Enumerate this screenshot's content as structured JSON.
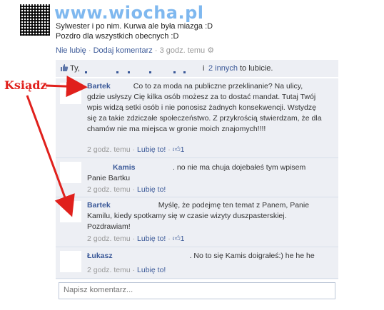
{
  "watermark": "www.wiocha.pl",
  "post": {
    "line1": "Sylwester i po nim. Kurwa ale była miazga :D",
    "line2": "Pozdro dla wszystkich obecnych :D",
    "actions": {
      "unlike": "Nie lubię",
      "comment": "Dodaj komentarz",
      "time": "3 godz. temu"
    }
  },
  "likes": {
    "prefix": "Ty,",
    "others_link": "2 innych",
    "suffix": "to lubicie.",
    "and_word": "i"
  },
  "annotation": "Ksiądz",
  "comments": [
    {
      "author": "Bartek",
      "text": "Co to za moda na publiczne przeklinanie? Na ulicy, gdzie usłyszy Cię kilka osób możesz za to dostać mandat. Tutaj Twój wpis widzą setki osób i nie ponosisz żadnych konsekwencji. Wstydzę się za takie zdziczałe społeczeństwo. Z przykrością stwierdzam, że dla chamów nie ma miejsca w gronie moich znajomych!!!!",
      "time": "2 godz. temu",
      "like": "Lubię to!",
      "likes": "1"
    },
    {
      "author": "Kamis",
      "text": ". no nie ma chuja dojebałeś tym wpisem Panie Bartku",
      "time": "2 godz. temu",
      "like": "Lubię to!",
      "likes": ""
    },
    {
      "author": "Bartek",
      "text": "Myślę, że podejmę ten temat z Panem, Panie Kamilu, kiedy spotkamy się w czasie wizyty duszpasterskiej. Pozdrawiam!",
      "time": "2 godz. temu",
      "like": "Lubię to!",
      "likes": "1"
    },
    {
      "author": "Łukasz",
      "text": ". No to się Kamis doigrałeś:) he he he",
      "time": "2 godz. temu",
      "like": "Lubię to!",
      "likes": ""
    }
  ],
  "comment_input": {
    "placeholder": "Napisz komentarz..."
  },
  "colors": {
    "link": "#3b5998",
    "panel": "#edeff4",
    "arrow": "#e0201c"
  }
}
